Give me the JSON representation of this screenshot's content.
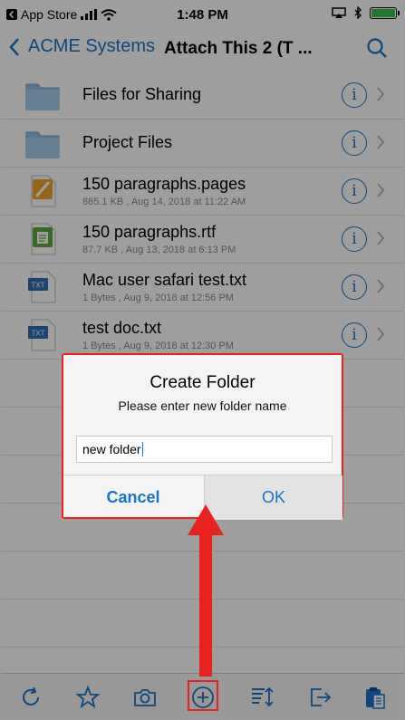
{
  "status_bar": {
    "back_app": "App Store",
    "time": "1:48 PM",
    "battery_level": 1.0
  },
  "nav": {
    "back_label": "ACME Systems",
    "title": "Attach This 2 (T ..."
  },
  "files": [
    {
      "name": "Files for Sharing",
      "meta": "",
      "type": "folder"
    },
    {
      "name": "Project Files",
      "meta": "",
      "type": "folder"
    },
    {
      "name": "150 paragraphs.pages",
      "meta": "865.1 KB , Aug 14, 2018 at 11:22 AM",
      "type": "pages"
    },
    {
      "name": "150 paragraphs.rtf",
      "meta": "87.7 KB , Aug 13, 2018 at 6:13 PM",
      "type": "rtf"
    },
    {
      "name": "Mac user safari test.txt",
      "meta": "1 Bytes , Aug 9, 2018 at 12:56 PM",
      "type": "txt"
    },
    {
      "name": "test doc.txt",
      "meta": "1 Bytes , Aug 9, 2018 at 12:30 PM",
      "type": "txt"
    }
  ],
  "dialog": {
    "title": "Create Folder",
    "message": "Please enter new folder name",
    "input_value": "new folder",
    "cancel_label": "Cancel",
    "ok_label": "OK"
  },
  "file_icon_labels": {
    "txt": "TXT"
  },
  "toolbar": {
    "icons": [
      "refresh-icon",
      "star-icon",
      "camera-icon",
      "add-icon",
      "sort-icon",
      "share-icon",
      "clipboard-icon"
    ]
  },
  "colors": {
    "accent": "#1a73c7",
    "annotation_red": "#e8231f",
    "folder_blue": "#8fbfe6"
  }
}
